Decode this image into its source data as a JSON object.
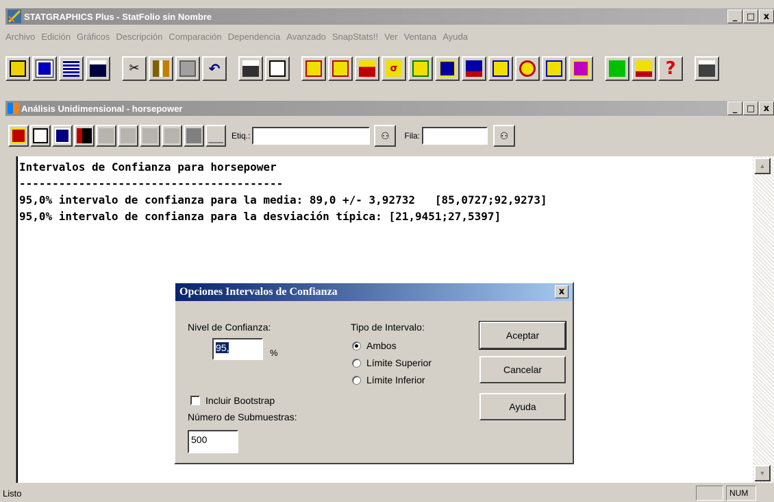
{
  "app": {
    "title": "STATGRAPHICS Plus - StatFolio sin Nombre"
  },
  "menu": [
    "Archivo",
    "Edición",
    "Gráficos",
    "Descripción",
    "Comparación",
    "Dependencia",
    "Avanzado",
    "SnapStats!!",
    "Ver",
    "Ventana",
    "Ayuda"
  ],
  "window_buttons": {
    "minimize": "_",
    "maximize": "□",
    "close": "x"
  },
  "child": {
    "title": "Análisis Unidimensional - horsepower",
    "toolbar": {
      "etiq_label": "Etiq.:",
      "etiq_value": "",
      "fila_label": "Fila:",
      "fila_value": ""
    }
  },
  "output": {
    "line1": "Intervalos de Confianza para horsepower",
    "line2": "----------------------------------------",
    "line3": "95,0% intervalo de confianza para la media: 89,0 +/- 3,92732   [85,0727;92,9273]",
    "line4": "95,0% intervalo de confianza para la desviación típica: [21,9451;27,5397]"
  },
  "dialog": {
    "title": "Opciones Intervalos de Confianza",
    "close": "x",
    "nivel_label": "Nivel de Confianza:",
    "nivel_value": "95,",
    "percent": "%",
    "tipo_label": "Tipo de Intervalo:",
    "radios": [
      {
        "label": "Ambos",
        "selected": true
      },
      {
        "label": "Límite Superior",
        "selected": false
      },
      {
        "label": "Límite Inferior",
        "selected": false
      }
    ],
    "bootstrap_label": "Incluir Bootstrap",
    "bootstrap_checked": false,
    "submuestras_label": "Número de Submuestras:",
    "submuestras_value": "500",
    "buttons": {
      "accept": "Aceptar",
      "cancel": "Cancelar",
      "help": "Ayuda"
    }
  },
  "status": {
    "text": "Listo",
    "num": "NUM"
  },
  "colors": {
    "dialog_title_bg": "#0a246a",
    "inactive_title": "#8f8f8f",
    "face": "#d4d0c8"
  }
}
